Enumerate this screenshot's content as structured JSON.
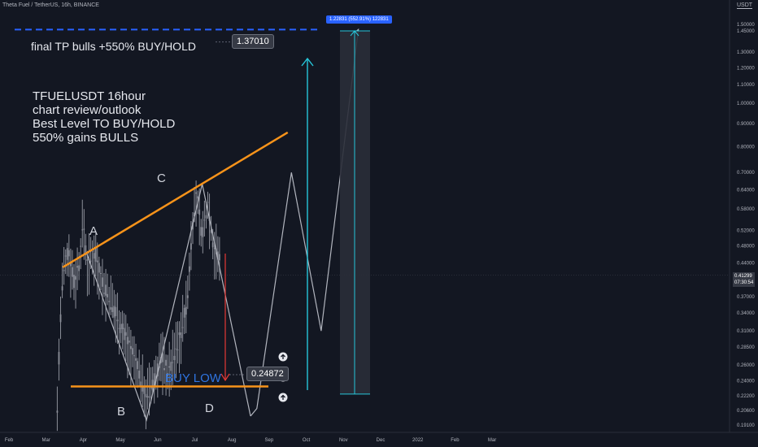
{
  "header": {
    "title": "Theta Fuel / TetherUS, 16h, BINANCE",
    "currency": "USDT"
  },
  "annotations": {
    "final_tp": "final TP bulls +550% BUY/HOLD",
    "target_price": "1.37010",
    "review_lines": [
      "TFUELUSDT 16hour",
      "chart review/outlook",
      "Best Level TO BUY/HOLD",
      "550% gains BULLS"
    ],
    "buy_low": "BUY LOW",
    "buy_price": "0.24872",
    "measure_label": "1.22831 (552.91%) 122831",
    "last_price": "0.41299",
    "countdown": "07:30:54"
  },
  "colors": {
    "background": "#131722",
    "candle": "#8c8f99",
    "trendline": "#f7931a",
    "projection": "#b2b5be",
    "arrow_cyan": "#26c6da",
    "arrow_red": "#e53935",
    "dash_blue": "#2962ff",
    "text_blue": "#2f74e0"
  },
  "chart_data": {
    "type": "line",
    "scale": "log",
    "y_ticks": [
      1.5,
      1.45,
      1.3,
      1.2,
      1.1,
      1.0,
      0.9,
      0.8,
      0.7,
      0.64,
      0.58,
      0.52,
      0.48,
      0.44,
      0.37,
      0.34,
      0.31,
      0.285,
      0.26,
      0.24,
      0.222,
      0.206,
      0.191
    ],
    "y_tick_labels": [
      "1.50000",
      "1.45000",
      "1.30000",
      "1.20000",
      "1.10000",
      "1.00000",
      "0.90000",
      "0.80000",
      "0.70000",
      "0.64000",
      "0.58000",
      "0.52000",
      "0.48000",
      "0.44000",
      "0.37000",
      "0.34000",
      "0.31000",
      "0.28500",
      "0.26000",
      "0.24000",
      "0.22200",
      "0.20600",
      "0.19100"
    ],
    "x_ticks": [
      "Feb",
      "Mar",
      "Apr",
      "May",
      "Jun",
      "Jul",
      "Aug",
      "Sep",
      "Oct",
      "Nov",
      "Dec",
      "2022",
      "Feb",
      "Mar"
    ],
    "waves": [
      {
        "label": "A",
        "month": 3.6,
        "value": 0.5
      },
      {
        "label": "B",
        "month": 4.7,
        "value": 0.2
      },
      {
        "label": "C",
        "month": 6.05,
        "value": 0.68
      },
      {
        "label": "D",
        "month": 7.5,
        "value": 0.2
      }
    ],
    "projection_path": [
      {
        "month": 6.5,
        "value": 0.64
      },
      {
        "month": 7.67,
        "value": 0.208
      },
      {
        "month": 8.6,
        "value": 0.7
      },
      {
        "month": 9.4,
        "value": 0.31
      },
      {
        "month": 10.4,
        "value": 1.46
      }
    ],
    "trendline": [
      {
        "month": 2.45,
        "value": 0.43
      },
      {
        "month": 8.5,
        "value": 0.86
      }
    ],
    "support_level": 0.233,
    "target_level": 1.46,
    "last_price": 0.41299,
    "measure": {
      "from": 0.224,
      "to": 1.45,
      "change": "552.91%"
    }
  }
}
